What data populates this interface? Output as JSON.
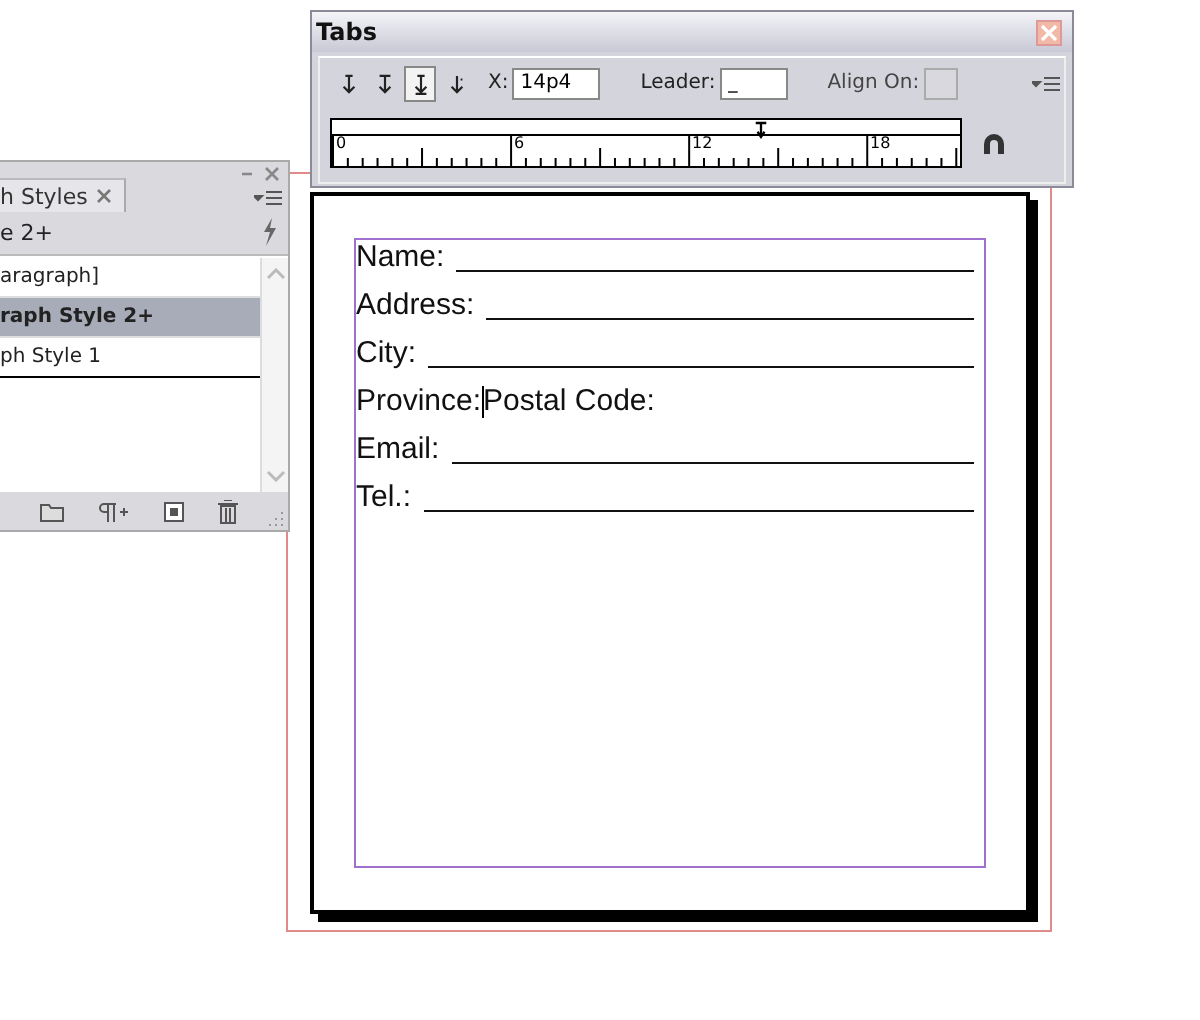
{
  "tabs_panel": {
    "title": "Tabs",
    "alignment_buttons": [
      {
        "kind": "left",
        "selected": false
      },
      {
        "kind": "center",
        "selected": false
      },
      {
        "kind": "right",
        "selected": true
      },
      {
        "kind": "decimal",
        "selected": false
      }
    ],
    "x_field": {
      "label": "X:",
      "value": "14p4"
    },
    "leader_field": {
      "label": "Leader:",
      "value": "_"
    },
    "align_on_field": {
      "label": "Align On:",
      "disabled": true
    },
    "ruler": {
      "labels": [
        "0",
        "6",
        "12",
        "18"
      ]
    }
  },
  "styles_panel": {
    "tab_label": "h Styles",
    "current_style": "e 2+",
    "items": [
      {
        "label": "aragraph]",
        "selected": false
      },
      {
        "label": "raph Style 2+",
        "selected": true
      },
      {
        "label": "ph Style 1",
        "selected": false
      }
    ]
  },
  "form": {
    "rows": [
      {
        "label": "Name:",
        "line": true,
        "cursor": false
      },
      {
        "label": "Address:",
        "line": true,
        "cursor": false
      },
      {
        "label": "City:",
        "line": true,
        "cursor": false
      },
      {
        "label": "Province:",
        "trailing": "Postal Code:",
        "line": false,
        "cursor": true
      },
      {
        "label": "Email:",
        "line": true,
        "cursor": false
      },
      {
        "label": "Tel.:",
        "line": true,
        "cursor": false
      }
    ]
  }
}
